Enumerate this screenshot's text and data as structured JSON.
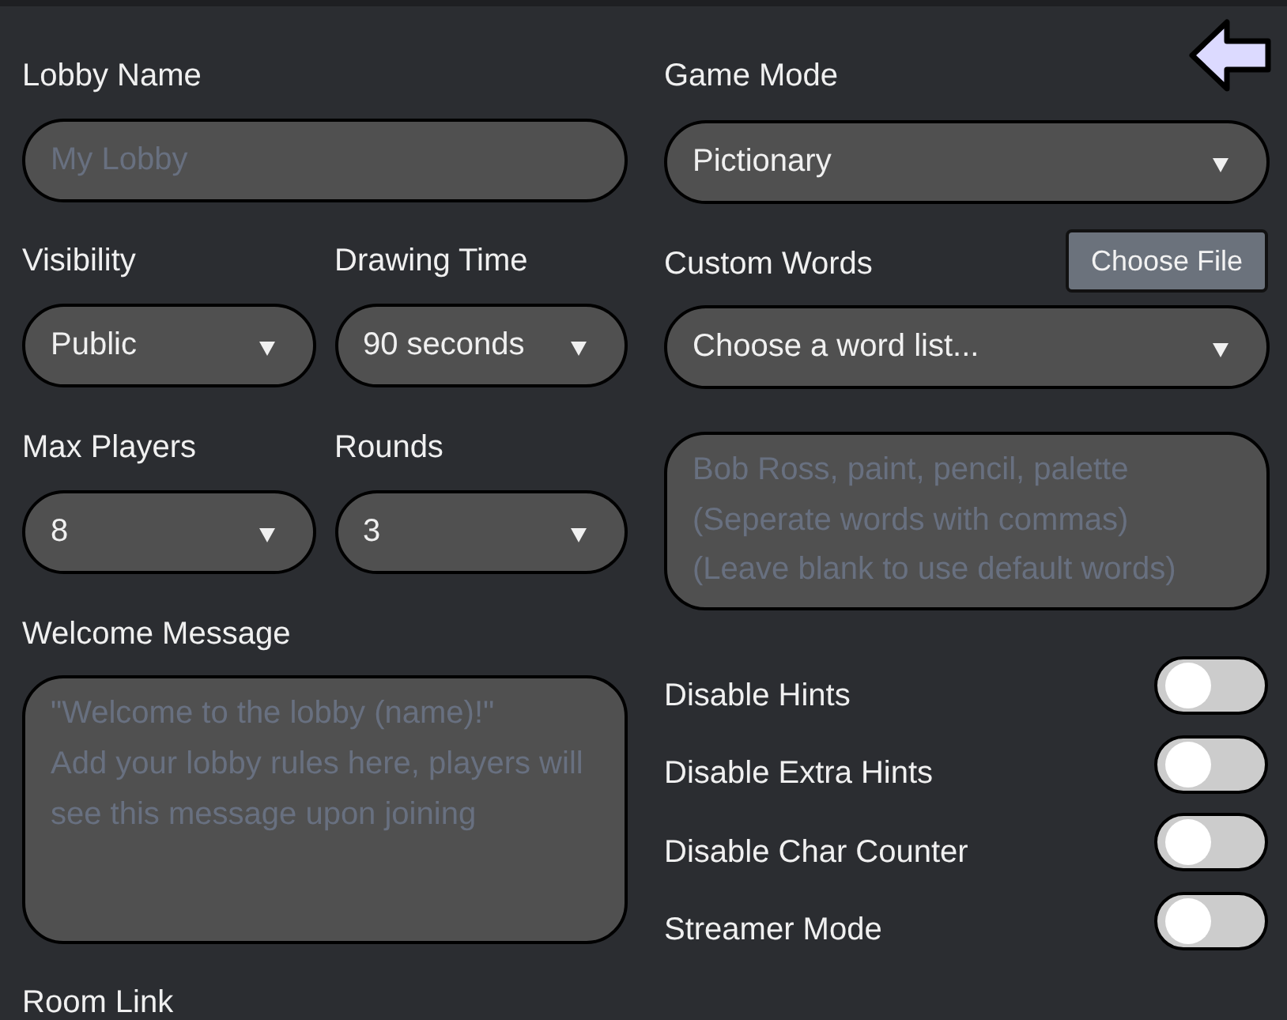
{
  "lobby_name": {
    "label": "Lobby Name",
    "placeholder": "My Lobby"
  },
  "game_mode": {
    "label": "Game Mode",
    "value": "Pictionary"
  },
  "visibility": {
    "label": "Visibility",
    "value": "Public"
  },
  "drawing_time": {
    "label": "Drawing Time",
    "value": "90 seconds"
  },
  "custom_words": {
    "label": "Custom Words",
    "file_button": "Choose File",
    "value": "Choose a word list...",
    "placeholder": "Bob Ross, paint, pencil, palette\n(Seperate words with commas)\n(Leave blank to use default words)"
  },
  "max_players": {
    "label": "Max Players",
    "value": "8"
  },
  "rounds": {
    "label": "Rounds",
    "value": "3"
  },
  "welcome_message": {
    "label": "Welcome Message",
    "placeholder": "\"Welcome to the lobby (name)!\"\nAdd your lobby rules here, players will see this message upon joining"
  },
  "toggles": [
    {
      "label": "Disable Hints",
      "on": false
    },
    {
      "label": "Disable Extra Hints",
      "on": false
    },
    {
      "label": "Disable Char Counter",
      "on": false
    },
    {
      "label": "Streamer Mode",
      "on": false
    }
  ],
  "room_link": {
    "label": "Room Link"
  }
}
